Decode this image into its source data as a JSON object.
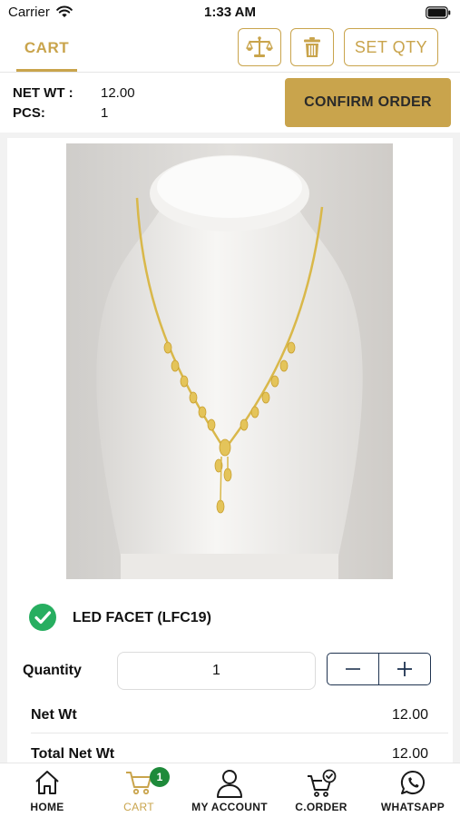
{
  "status_bar": {
    "carrier": "Carrier",
    "time": "1:33 AM"
  },
  "top_bar": {
    "cart_tab": "CART",
    "set_qty_label": "SET QTY",
    "accent_color": "#c9a44c"
  },
  "summary": {
    "net_wt_label": "NET WT :",
    "net_wt_value": "12.00",
    "pcs_label": "PCS:",
    "pcs_value": "1",
    "confirm_label": "CONFIRM ORDER"
  },
  "product": {
    "title": "LED FACET (LFC19)",
    "selected": true,
    "quantity_label": "Quantity",
    "quantity_value": "1",
    "rows": [
      {
        "label": "Net Wt",
        "value": "12.00"
      },
      {
        "label": "Total Net Wt",
        "value": "12.00"
      }
    ]
  },
  "bottom_nav": {
    "items": [
      {
        "label": "HOME",
        "icon": "home-icon",
        "active": false
      },
      {
        "label": "CART",
        "icon": "cart-icon",
        "active": true,
        "badge": "1"
      },
      {
        "label": "MY ACCOUNT",
        "icon": "account-icon",
        "active": false
      },
      {
        "label": "C.ORDER",
        "icon": "cart-check-icon",
        "active": false
      },
      {
        "label": "WHATSAPP",
        "icon": "whatsapp-icon",
        "active": false
      }
    ]
  }
}
